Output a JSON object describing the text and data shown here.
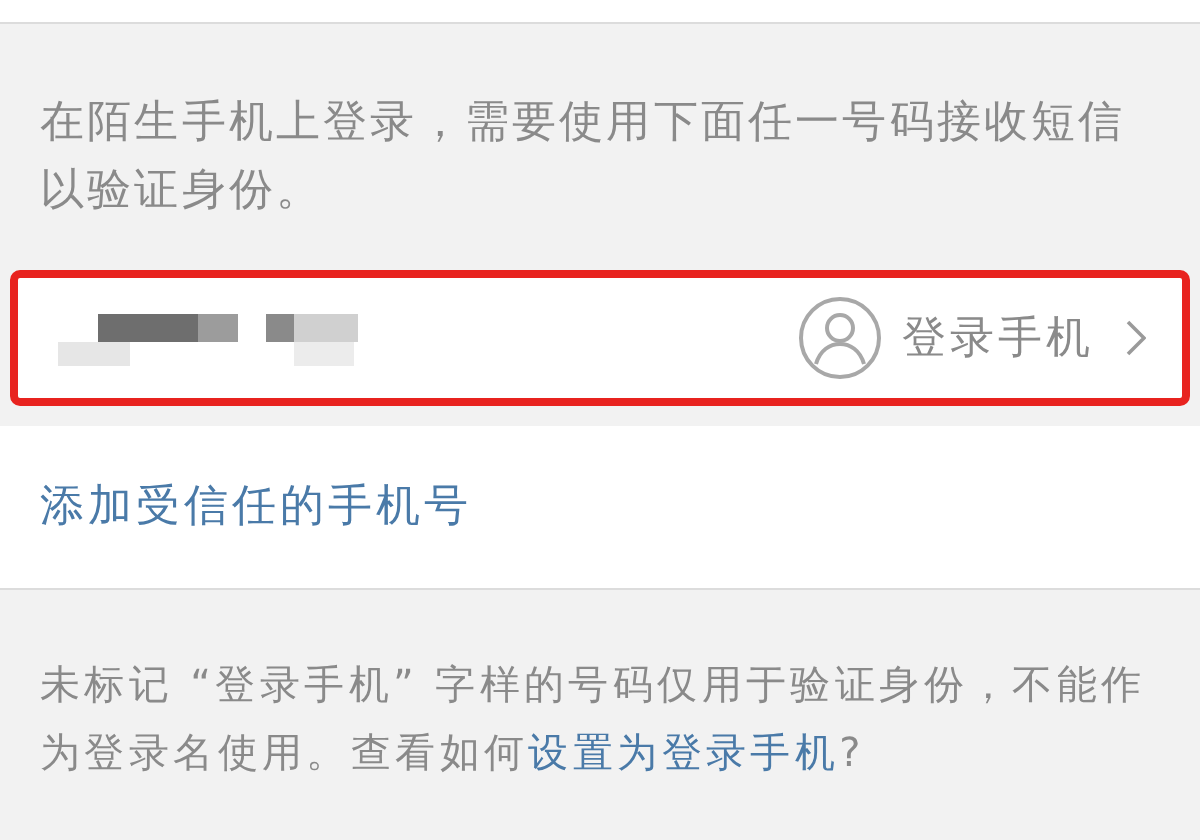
{
  "intro": "在陌生手机上登录，需要使用下面任一号码接收短信以验证身份。",
  "phone_row": {
    "label": "登录手机",
    "highlighted": true
  },
  "add_link": "添加受信任的手机号",
  "note": {
    "before": "未标记 “登录手机” 字样的号码仅用于验证身份，不能作为登录名使用。查看如何",
    "link": "设置为登录手机",
    "after": "?"
  }
}
